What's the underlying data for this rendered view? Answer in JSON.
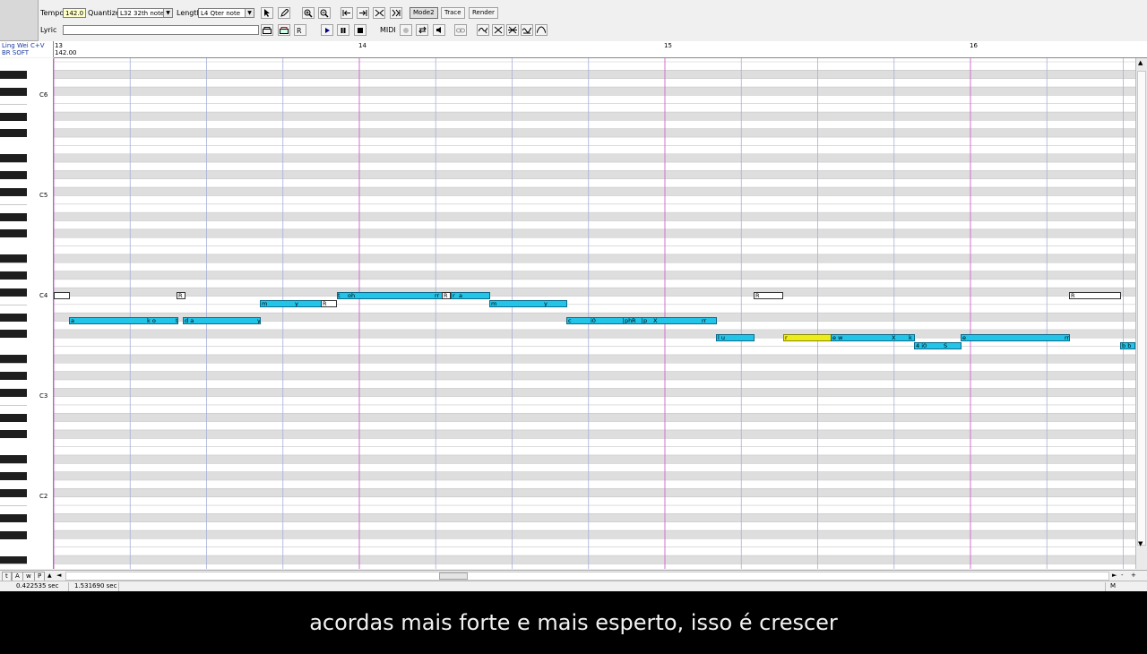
{
  "toolbar": {
    "tempo_label": "Tempo",
    "tempo_value": "142.0",
    "quantize_label": "Quantize",
    "quantize_value": "L32 32th note",
    "length_label": "Length",
    "length_value": "L4  Qter note",
    "lyric_label": "Lyric",
    "lyric_value": "",
    "midi_label": "MIDI",
    "mode2_label": "Mode2",
    "trace_label": "Trace",
    "render_label": "Render",
    "icons": [
      "arrow-cursor-icon",
      "pencil-icon",
      "zoom-in-icon",
      "zoom-out-icon",
      "jump-start-icon",
      "jump-end-icon",
      "cut-notes-icon",
      "join-notes-icon",
      "envelope-icon",
      "rest-icon",
      "lyric-r-icon",
      "play-icon",
      "pause-icon",
      "stop-icon",
      "metronome-icon",
      "loop-icon",
      "mute-icon",
      "link-icon",
      "pitch-edit-icon",
      "vibrato-icon",
      "envelope-edit-icon",
      "modulation-icon",
      "portamento-icon"
    ]
  },
  "track": {
    "singer": "Ling Wei C+V",
    "voice_type": "BR SOFT"
  },
  "ruler": {
    "measures": [
      "13",
      "14",
      "15",
      "16"
    ],
    "tempo_marker": "142.00"
  },
  "keyboard": {
    "octave_labels": [
      "C6",
      "C5",
      "C4",
      "C3",
      "C2"
    ]
  },
  "notes": [
    {
      "lyric": "",
      "type": "rest",
      "pitch": "C4"
    },
    {
      "lyric": "R",
      "type": "rest",
      "pitch": "C4"
    },
    {
      "lyric": "a",
      "type": "note",
      "pitch": "A3",
      "labels": [
        "a",
        "k o",
        "t"
      ]
    },
    {
      "lyric": "d a",
      "type": "note",
      "pitch": "A3",
      "labels": [
        "d a",
        "y"
      ]
    },
    {
      "lyric": "m",
      "type": "note",
      "pitch": "B3",
      "labels": [
        "m",
        "y"
      ]
    },
    {
      "lyric": "R",
      "type": "rest",
      "pitch": "B3"
    },
    {
      "lyric": "t oh",
      "type": "note",
      "pitch": "C4",
      "labels": [
        "t",
        "oh",
        "rr"
      ]
    },
    {
      "lyric": "R",
      "type": "rest",
      "pitch": "C4"
    },
    {
      "lyric": "r o",
      "type": "note",
      "pitch": "C4",
      "labels": [
        "r",
        "a"
      ]
    },
    {
      "lyric": "m",
      "type": "note",
      "pitch": "B3",
      "labels": [
        "m",
        "y"
      ]
    },
    {
      "lyric": "c",
      "type": "note",
      "pitch": "A3",
      "labels": [
        "c",
        "i0"
      ]
    },
    {
      "lyric": "ph",
      "type": "note",
      "pitch": "A3",
      "labels": [
        "ph",
        "R"
      ]
    },
    {
      "lyric": "p",
      "type": "note",
      "pitch": "A3",
      "labels": [
        "p",
        "X",
        "rr"
      ]
    },
    {
      "lyric": "l u",
      "type": "note",
      "pitch": "G3",
      "labels": [
        "l u"
      ]
    },
    {
      "lyric": "R",
      "type": "rest",
      "pitch": "C4"
    },
    {
      "lyric": "r",
      "type": "selected",
      "pitch": "G3",
      "labels": [
        "r"
      ]
    },
    {
      "lyric": "e w",
      "type": "note",
      "pitch": "G3",
      "labels": [
        "e w",
        "X",
        "k"
      ]
    },
    {
      "lyric": "4 i0",
      "type": "note",
      "pitch": "F3",
      "labels": [
        "4 i0",
        "S"
      ]
    },
    {
      "lyric": "e",
      "type": "note",
      "pitch": "G3",
      "labels": [
        "e",
        "rr"
      ]
    },
    {
      "lyric": "R",
      "type": "rest",
      "pitch": "C4"
    },
    {
      "lyric": "b b",
      "type": "note",
      "pitch": "F3",
      "labels": [
        "b b"
      ]
    }
  ],
  "bottom_tabs": [
    "t",
    "A",
    "w",
    "P"
  ],
  "status": {
    "cell1": "0.422535 sec",
    "cell2": "1.531690 sec",
    "cell3": "M"
  },
  "subtitle": "acordas mais forte e mais esperto, isso é crescer"
}
